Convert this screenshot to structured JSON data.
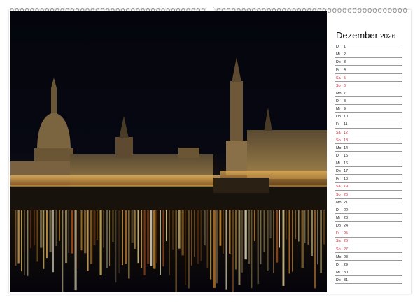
{
  "calendar": {
    "month": "Dezember",
    "year": "2026",
    "weekend_color": "#d0243a",
    "days": [
      {
        "wd": "Di",
        "d": "1",
        "weekend": false
      },
      {
        "wd": "Mi",
        "d": "2",
        "weekend": false
      },
      {
        "wd": "Do",
        "d": "3",
        "weekend": false
      },
      {
        "wd": "Fr",
        "d": "4",
        "weekend": false
      },
      {
        "wd": "Sa",
        "d": "5",
        "weekend": true
      },
      {
        "wd": "So",
        "d": "6",
        "weekend": true
      },
      {
        "wd": "Mo",
        "d": "7",
        "weekend": false
      },
      {
        "wd": "Di",
        "d": "8",
        "weekend": false
      },
      {
        "wd": "Mi",
        "d": "9",
        "weekend": false
      },
      {
        "wd": "Do",
        "d": "10",
        "weekend": false
      },
      {
        "wd": "Fr",
        "d": "11",
        "weekend": false
      },
      {
        "wd": "Sa",
        "d": "12",
        "weekend": true
      },
      {
        "wd": "So",
        "d": "13",
        "weekend": true
      },
      {
        "wd": "Mo",
        "d": "14",
        "weekend": false
      },
      {
        "wd": "Di",
        "d": "15",
        "weekend": false
      },
      {
        "wd": "Mi",
        "d": "16",
        "weekend": false
      },
      {
        "wd": "Do",
        "d": "17",
        "weekend": false
      },
      {
        "wd": "Fr",
        "d": "18",
        "weekend": false
      },
      {
        "wd": "Sa",
        "d": "19",
        "weekend": true
      },
      {
        "wd": "So",
        "d": "20",
        "weekend": true
      },
      {
        "wd": "Mo",
        "d": "21",
        "weekend": false
      },
      {
        "wd": "Di",
        "d": "22",
        "weekend": false
      },
      {
        "wd": "Mi",
        "d": "23",
        "weekend": false
      },
      {
        "wd": "Do",
        "d": "24",
        "weekend": false
      },
      {
        "wd": "Fr",
        "d": "25",
        "weekend": true
      },
      {
        "wd": "Sa",
        "d": "26",
        "weekend": true
      },
      {
        "wd": "So",
        "d": "27",
        "weekend": true
      },
      {
        "wd": "Mo",
        "d": "28",
        "weekend": false
      },
      {
        "wd": "Di",
        "d": "29",
        "weekend": false
      },
      {
        "wd": "Mi",
        "d": "30",
        "weekend": false
      },
      {
        "wd": "Do",
        "d": "31",
        "weekend": false
      }
    ]
  }
}
